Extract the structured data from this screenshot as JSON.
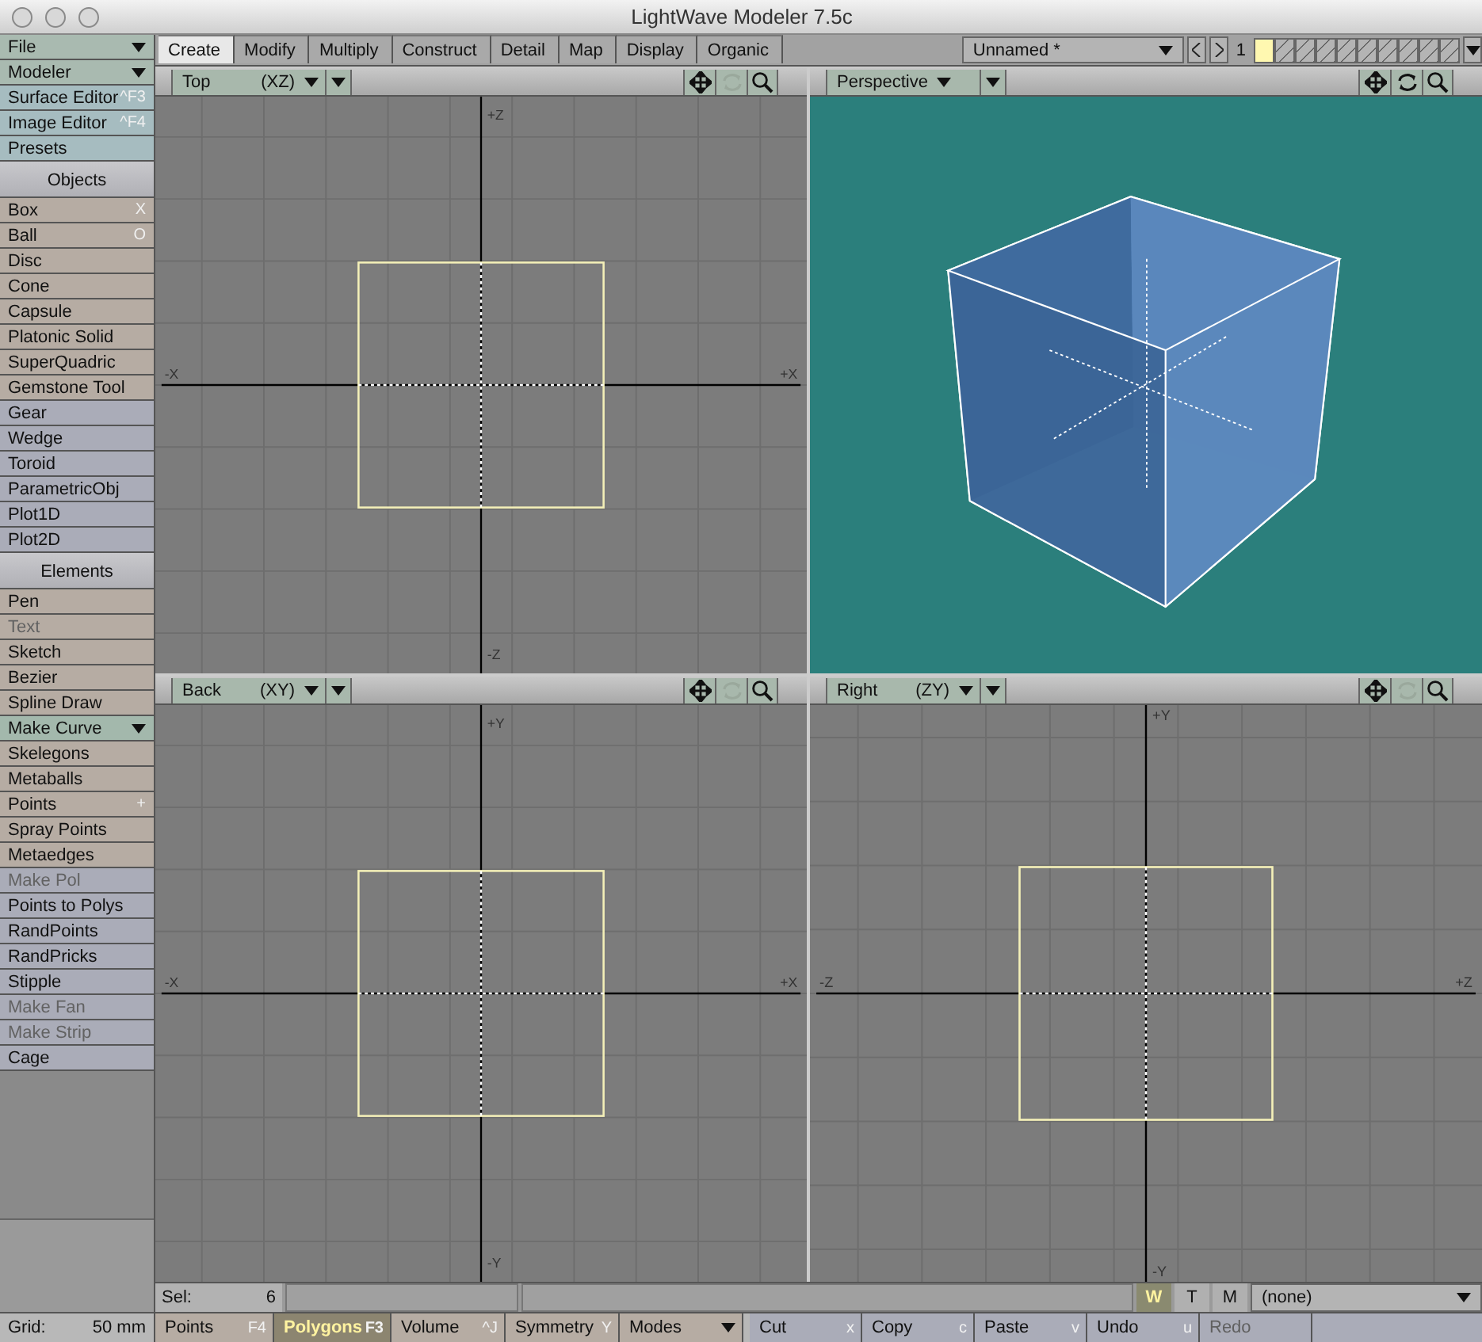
{
  "window": {
    "title": "LightWave Modeler 7.5c"
  },
  "sidebar": {
    "items": [
      {
        "kind": "menu",
        "label": "File",
        "color": "#a9bab0"
      },
      {
        "kind": "menu",
        "label": "Modeler",
        "color": "#a9bab0"
      },
      {
        "kind": "tool",
        "label": "Surface Editor",
        "shortcut": "^F3",
        "disabled": false,
        "color": "#a6bcc0"
      },
      {
        "kind": "tool",
        "label": "Image Editor",
        "shortcut": "^F4",
        "disabled": false,
        "color": "#a6bcc0"
      },
      {
        "kind": "tool",
        "label": "Presets",
        "disabled": false,
        "color": "#a6bcc0"
      },
      {
        "kind": "header",
        "label": "Objects"
      },
      {
        "kind": "tool",
        "label": "Box",
        "shortcut": "X",
        "disabled": false,
        "color": "#b6aca3"
      },
      {
        "kind": "tool",
        "label": "Ball",
        "shortcut": "O",
        "disabled": false,
        "color": "#b6aca3"
      },
      {
        "kind": "tool",
        "label": "Disc",
        "disabled": false,
        "color": "#b6aca3"
      },
      {
        "kind": "tool",
        "label": "Cone",
        "disabled": false,
        "color": "#b6aca3"
      },
      {
        "kind": "tool",
        "label": "Capsule",
        "disabled": false,
        "color": "#b6aca3"
      },
      {
        "kind": "tool",
        "label": "Platonic Solid",
        "disabled": false,
        "color": "#b6aca3"
      },
      {
        "kind": "tool",
        "label": "SuperQuadric",
        "disabled": false,
        "color": "#b6aca3"
      },
      {
        "kind": "tool",
        "label": "Gemstone Tool",
        "disabled": false,
        "color": "#b6aca3"
      },
      {
        "kind": "tool",
        "label": "Gear",
        "disabled": false,
        "color": "#aaacb8"
      },
      {
        "kind": "tool",
        "label": "Wedge",
        "disabled": false,
        "color": "#aaacb8"
      },
      {
        "kind": "tool",
        "label": "Toroid",
        "disabled": false,
        "color": "#aaacb8"
      },
      {
        "kind": "tool",
        "label": "ParametricObj",
        "disabled": false,
        "color": "#aaacb8"
      },
      {
        "kind": "tool",
        "label": "Plot1D",
        "disabled": false,
        "color": "#aaacb8"
      },
      {
        "kind": "tool",
        "label": "Plot2D",
        "disabled": false,
        "color": "#aaacb8"
      },
      {
        "kind": "header",
        "label": "Elements"
      },
      {
        "kind": "tool",
        "label": "Pen",
        "disabled": false,
        "color": "#b6aca3"
      },
      {
        "kind": "tool",
        "label": "Text",
        "disabled": true,
        "color": "#b6aca3"
      },
      {
        "kind": "tool",
        "label": "Sketch",
        "disabled": false,
        "color": "#b6aca3"
      },
      {
        "kind": "tool",
        "label": "Bezier",
        "disabled": false,
        "color": "#b6aca3"
      },
      {
        "kind": "tool",
        "label": "Spline Draw",
        "disabled": false,
        "color": "#b6aca3"
      },
      {
        "kind": "menu",
        "label": "Make Curve",
        "color": "#a3b8ac"
      },
      {
        "kind": "tool",
        "label": "Skelegons",
        "disabled": false,
        "color": "#b6aca3"
      },
      {
        "kind": "tool",
        "label": "Metaballs",
        "disabled": false,
        "color": "#b6aca3"
      },
      {
        "kind": "tool",
        "label": "Points",
        "shortcut": "+",
        "disabled": false,
        "color": "#b6aca3"
      },
      {
        "kind": "tool",
        "label": "Spray Points",
        "disabled": false,
        "color": "#b6aca3"
      },
      {
        "kind": "tool",
        "label": "Metaedges",
        "disabled": false,
        "color": "#b6aca3"
      },
      {
        "kind": "tool",
        "label": "Make Pol",
        "disabled": true,
        "color": "#aaacb8"
      },
      {
        "kind": "tool",
        "label": "Points to Polys",
        "disabled": false,
        "color": "#aaacb8"
      },
      {
        "kind": "tool",
        "label": "RandPoints",
        "disabled": false,
        "color": "#aaacb8"
      },
      {
        "kind": "tool",
        "label": "RandPricks",
        "disabled": false,
        "color": "#aaacb8"
      },
      {
        "kind": "tool",
        "label": "Stipple",
        "disabled": false,
        "color": "#aaacb8"
      },
      {
        "kind": "tool",
        "label": "Make Fan",
        "disabled": true,
        "color": "#aaacb8"
      },
      {
        "kind": "tool",
        "label": "Make Strip",
        "disabled": true,
        "color": "#aaacb8"
      },
      {
        "kind": "tool",
        "label": "Cage",
        "disabled": false,
        "color": "#aaacb8"
      }
    ],
    "grid_label": "Grid:",
    "grid_value": "50 mm"
  },
  "tabs": [
    {
      "label": "Create",
      "selected": true
    },
    {
      "label": "Modify",
      "selected": false
    },
    {
      "label": "Multiply",
      "selected": false
    },
    {
      "label": "Construct",
      "selected": false
    },
    {
      "label": "Detail",
      "selected": false
    },
    {
      "label": "Map",
      "selected": false
    },
    {
      "label": "Display",
      "selected": false
    },
    {
      "label": "Organic",
      "selected": false
    }
  ],
  "object_menu": {
    "value": "Unnamed *"
  },
  "layer_number": "1",
  "layers": [
    {
      "selected": true
    },
    {
      "selected": false
    },
    {
      "selected": false
    },
    {
      "selected": false
    },
    {
      "selected": false
    },
    {
      "selected": false
    },
    {
      "selected": false
    },
    {
      "selected": false
    },
    {
      "selected": false
    },
    {
      "selected": false
    }
  ],
  "viewports": [
    {
      "kind": "ortho",
      "title": "Top",
      "axes": "(XZ)",
      "rotate_disabled": true,
      "labels": {
        "top": "+Z",
        "bottom": "-Z",
        "left": "-X",
        "right": "+X"
      }
    },
    {
      "kind": "perspective",
      "title": "Perspective",
      "rotate_disabled": false
    },
    {
      "kind": "ortho",
      "title": "Back",
      "axes": "(XY)",
      "rotate_disabled": true,
      "labels": {
        "top": "+Y",
        "bottom": "-Y",
        "left": "-X",
        "right": "+X"
      }
    },
    {
      "kind": "ortho",
      "title": "Right",
      "axes": "(ZY)",
      "rotate_disabled": true,
      "labels": {
        "top": "+Y",
        "bottom": "-Y",
        "left": "-Z",
        "right": "+Z"
      }
    }
  ],
  "selection": {
    "label": "Sel:",
    "count": "6"
  },
  "modes": [
    {
      "label": "W",
      "selected": true
    },
    {
      "label": "T",
      "selected": false
    },
    {
      "label": "M",
      "selected": false
    }
  ],
  "surface_menu": {
    "value": "(none)"
  },
  "bottom_bar": [
    {
      "kind": "mode",
      "label": "Points",
      "shortcut": "F4",
      "selected": false
    },
    {
      "kind": "mode",
      "label": "Polygons",
      "shortcut": "F3",
      "selected": true
    },
    {
      "kind": "mode",
      "label": "Volume",
      "shortcut": "^J",
      "selected": false
    },
    {
      "kind": "mode",
      "label": "Symmetry",
      "shortcut": "Y",
      "selected": false
    },
    {
      "kind": "menu",
      "label": "Modes"
    },
    {
      "kind": "action",
      "label": "Cut",
      "shortcut": "x",
      "disabled": false
    },
    {
      "kind": "action",
      "label": "Copy",
      "shortcut": "c",
      "disabled": false
    },
    {
      "kind": "action",
      "label": "Paste",
      "shortcut": "v",
      "disabled": false
    },
    {
      "kind": "action",
      "label": "Undo",
      "shortcut": "u",
      "disabled": false
    },
    {
      "kind": "action",
      "label": "Redo",
      "disabled": true
    }
  ]
}
